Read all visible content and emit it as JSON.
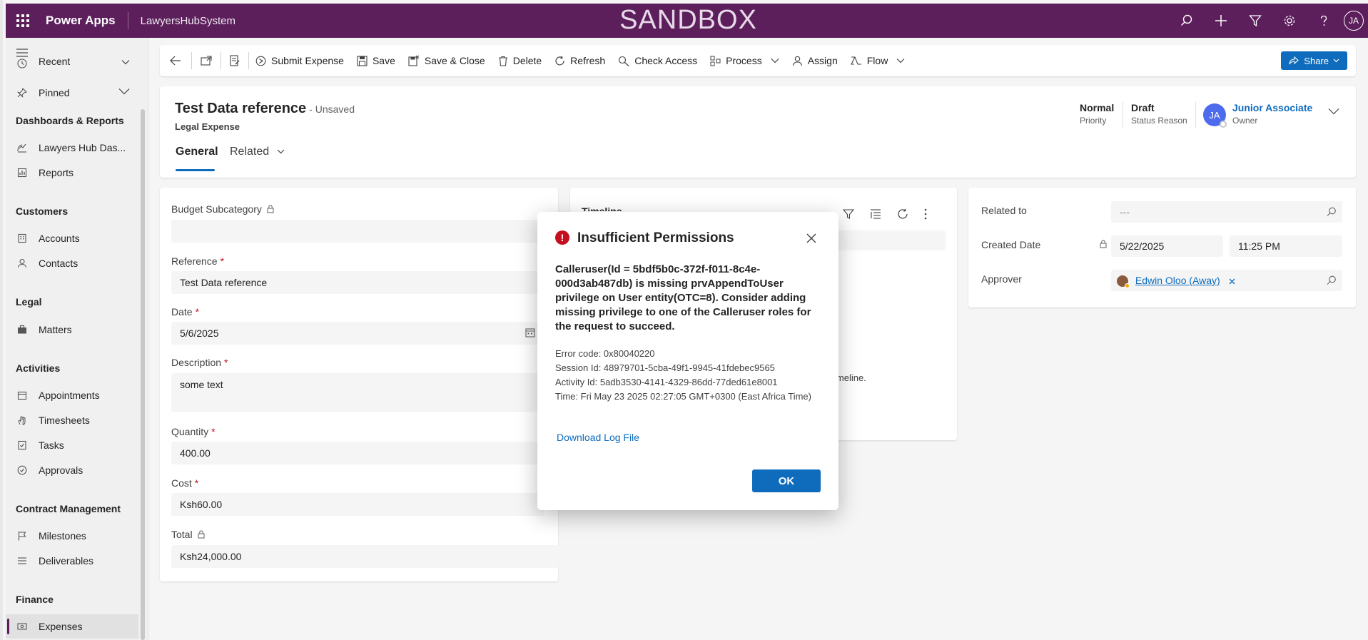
{
  "header": {
    "app_name": "Power Apps",
    "environment": "LawyersHubSystem",
    "banner": "SANDBOX",
    "user_initials": "JA"
  },
  "sidebar": {
    "recent": "Recent",
    "pinned": "Pinned",
    "groups": [
      {
        "title": "Dashboards & Reports",
        "items": [
          "Lawyers Hub Das...",
          "Reports"
        ]
      },
      {
        "title": "Customers",
        "items": [
          "Accounts",
          "Contacts"
        ]
      },
      {
        "title": "Legal",
        "items": [
          "Matters"
        ]
      },
      {
        "title": "Activities",
        "items": [
          "Appointments",
          "Timesheets",
          "Tasks",
          "Approvals"
        ]
      },
      {
        "title": "Contract Management",
        "items": [
          "Milestones",
          "Deliverables"
        ]
      },
      {
        "title": "Finance",
        "items": [
          "Expenses"
        ]
      }
    ]
  },
  "commands": {
    "submit_expense": "Submit Expense",
    "save": "Save",
    "save_close": "Save & Close",
    "delete": "Delete",
    "refresh": "Refresh",
    "check_access": "Check Access",
    "process": "Process",
    "assign": "Assign",
    "flow": "Flow",
    "share": "Share"
  },
  "record": {
    "title": "Test Data reference",
    "unsaved": "- Unsaved",
    "entity": "Legal Expense",
    "tabs": [
      "General",
      "Related"
    ],
    "priority_value": "Normal",
    "priority_label": "Priority",
    "status_value": "Draft",
    "status_label": "Status Reason",
    "owner_initials": "JA",
    "owner_name": "Junior Associate",
    "owner_label": "Owner"
  },
  "form": {
    "budget_subcategory_label": "Budget Subcategory",
    "reference_label": "Reference",
    "reference_value": "Test Data reference",
    "date_label": "Date",
    "date_value": "5/6/2025",
    "description_label": "Description",
    "description_value": "some text",
    "quantity_label": "Quantity",
    "quantity_value": "400.00",
    "cost_label": "Cost",
    "cost_value": "Ksh60.00",
    "total_label": "Total",
    "total_value": "Ksh24,000.00",
    "required_mark": "*"
  },
  "timeline": {
    "title": "Timeline",
    "partial_text": "imeline."
  },
  "right_panel": {
    "related_to_label": "Related to",
    "related_to_value": "---",
    "created_date_label": "Created Date",
    "created_date_value": "5/22/2025",
    "created_time_value": "11:25 PM",
    "approver_label": "Approver",
    "approver_value": "Edwin Oloo (Away)"
  },
  "dialog": {
    "title": "Insufficient Permissions",
    "message": "Calleruser(Id = 5bdf5b0c-372f-f011-8c4e-000d3ab487db) is missing prvAppendToUser privilege on User entity(OTC=8). Consider adding missing privilege to one of the Calleruser roles for the request to succeed.",
    "error_code": "Error code: 0x80040220",
    "session_id": "Session Id: 48979701-5cba-49f1-9945-41fdebec9565",
    "activity_id": "Activity Id: 5adb3530-4141-4329-86dd-77ded61e8001",
    "time": "Time: Fri May 23 2025 02:27:05 GMT+0300 (East Africa Time)",
    "download_link": "Download Log File",
    "ok_label": "OK"
  },
  "colors": {
    "header_bg": "#5c1f5c",
    "primary": "#0f6cbd",
    "error": "#c50f1f"
  }
}
